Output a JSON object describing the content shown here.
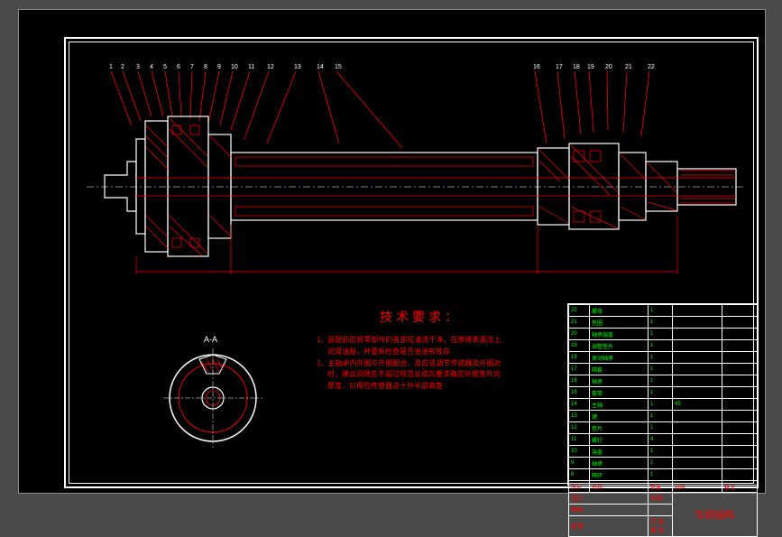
{
  "part_numbers": [
    "1",
    "2",
    "3",
    "4",
    "5",
    "6",
    "7",
    "8",
    "9",
    "10",
    "11",
    "12",
    "13",
    "14",
    "15",
    "16",
    "17",
    "18",
    "19",
    "20",
    "21",
    "22"
  ],
  "section_label": "A-A",
  "tech_req": {
    "title": "技术要求：",
    "line1": "1、装配前应将零部件的各部位清洗干净，在摩擦表面涂上",
    "line2": "润滑油脂，并重新检查是否油油有残存",
    "line3": "2、主轴承内外圈与外圈配合，及应该调节传感器及外圈对",
    "line4": "时，建议间隙应不超过规范总成的要求确定补偿垫片的",
    "line5": "厚度，以保险传感器这十外半部高垫"
  },
  "parts_list": [
    {
      "no": "22",
      "name": "螺母",
      "qty": "1",
      "material": "",
      "note": ""
    },
    {
      "no": "21",
      "name": "垫圈",
      "qty": "1",
      "material": "",
      "note": ""
    },
    {
      "no": "20",
      "name": "轴承端盖",
      "qty": "1",
      "material": "",
      "note": ""
    },
    {
      "no": "19",
      "name": "调整垫片",
      "qty": "1",
      "material": "",
      "note": ""
    },
    {
      "no": "18",
      "name": "滚动轴承",
      "qty": "1",
      "material": "",
      "note": ""
    },
    {
      "no": "17",
      "name": "隔套",
      "qty": "1",
      "material": "",
      "note": ""
    },
    {
      "no": "16",
      "name": "轴承",
      "qty": "1",
      "material": "",
      "note": ""
    },
    {
      "no": "15",
      "name": "套筒",
      "qty": "1",
      "material": "",
      "note": ""
    },
    {
      "no": "14",
      "name": "主轴",
      "qty": "1",
      "material": "45",
      "note": ""
    },
    {
      "no": "13",
      "name": "键",
      "qty": "1",
      "material": "",
      "note": ""
    },
    {
      "no": "12",
      "name": "垫片",
      "qty": "1",
      "material": "",
      "note": ""
    },
    {
      "no": "11",
      "name": "螺钉",
      "qty": "4",
      "material": "",
      "note": ""
    },
    {
      "no": "10",
      "name": "端盖",
      "qty": "1",
      "material": "",
      "note": ""
    },
    {
      "no": "9",
      "name": "轴承",
      "qty": "1",
      "material": "",
      "note": ""
    },
    {
      "no": "8",
      "name": "隔环",
      "qty": "1",
      "material": "",
      "note": ""
    }
  ],
  "title_block": {
    "headers": [
      "序号",
      "名称",
      "数量",
      "材料",
      "备注"
    ],
    "drawing_name": "车削轴构",
    "scale_label": "比例",
    "scale": "",
    "sheet_label": "共 张 第 张",
    "designer_label": "设计",
    "checker_label": "审核",
    "approver_label": "批准"
  }
}
